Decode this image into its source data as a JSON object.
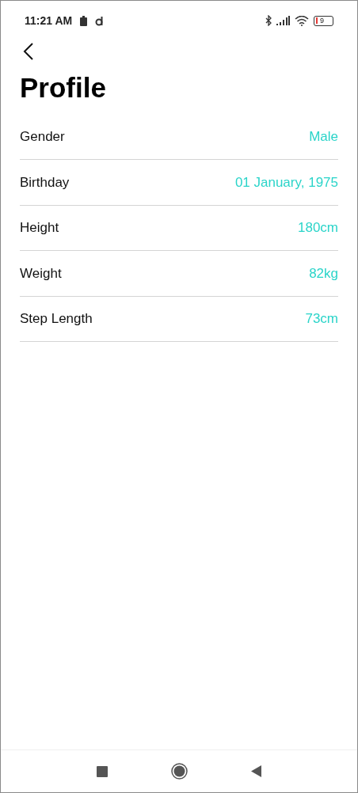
{
  "status_bar": {
    "time": "11:21 AM",
    "battery": "9"
  },
  "title": "Profile",
  "fields": [
    {
      "label": "Gender",
      "value": "Male"
    },
    {
      "label": "Birthday",
      "value": "01 January, 1975"
    },
    {
      "label": "Height",
      "value": "180cm"
    },
    {
      "label": "Weight",
      "value": "82kg"
    },
    {
      "label": "Step Length",
      "value": "73cm"
    }
  ]
}
